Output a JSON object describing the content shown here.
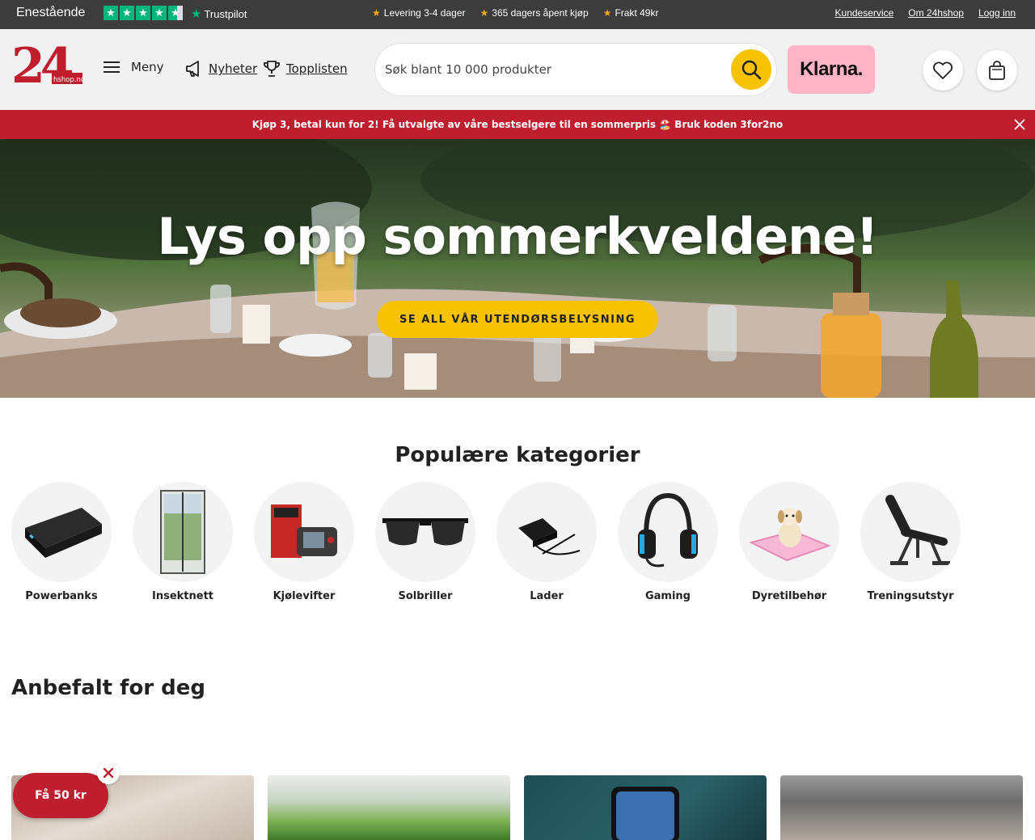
{
  "topbar": {
    "trust_label": "Enestående",
    "trust_brand": "Trustpilot",
    "rating_stars": 4.5,
    "usps": [
      "Levering 3-4 dager",
      "365 dagers åpent kjøp",
      "Frakt 49kr"
    ],
    "links": [
      "Kundeservice",
      "Om 24hshop",
      "Logg inn"
    ]
  },
  "header": {
    "logo_text": "24",
    "logo_subtext": "hshop.no",
    "menu_label": "Meny",
    "news_label": "Nyheter",
    "toplist_label": "Topplisten",
    "search_placeholder": "Søk blant 10 000 produkter",
    "klarna_label": "Klarna."
  },
  "promo": {
    "text": "Kjøp 3, betal kun for 2! Få utvalgte av våre bestselgere til en sommerpris 🏖️ Bruk koden 3for2no"
  },
  "hero": {
    "title": "Lys opp sommerkveldene!",
    "cta": "SE ALL VÅR UTENDØRSBELYSNING"
  },
  "categories": {
    "heading": "Populære kategorier",
    "items": [
      {
        "label": "Powerbanks",
        "icon": "powerbank-icon"
      },
      {
        "label": "Insektnett",
        "icon": "insect-net-icon"
      },
      {
        "label": "Kjølevifter",
        "icon": "diagnostic-tool-icon"
      },
      {
        "label": "Solbriller",
        "icon": "sunglasses-icon"
      },
      {
        "label": "Lader",
        "icon": "charger-icon"
      },
      {
        "label": "Gaming",
        "icon": "headset-icon"
      },
      {
        "label": "Dyretilbehør",
        "icon": "puppy-pad-icon"
      },
      {
        "label": "Treningsutstyr",
        "icon": "bench-icon"
      }
    ]
  },
  "recommended": {
    "heading": "Anbefalt for deg"
  },
  "coupon": {
    "label": "Få 50 kr"
  },
  "colors": {
    "brand_red": "#be1e2d",
    "accent_yellow": "#f7c200",
    "topbar_bg": "#3c3c3c",
    "header_bg": "#f1f1f1",
    "klarna_pink": "#ffb3c7",
    "trustpilot_green": "#00b67a"
  }
}
